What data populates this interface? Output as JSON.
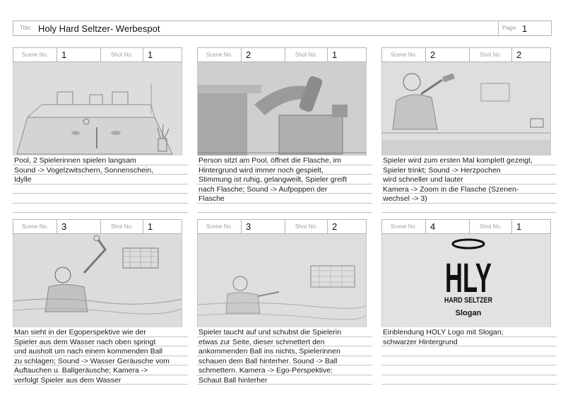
{
  "title": {
    "label": "Title:",
    "value": "Holy Hard Seltzer- Werbespot"
  },
  "page": {
    "label": "Page:",
    "value": "1"
  },
  "header_labels": {
    "scene": "Scene No.",
    "shot": "Shot No."
  },
  "panels": [
    {
      "scene": "1",
      "shot": "1",
      "description": [
        "Pool, 2 Spielerinnen spielen langsam",
        "Sound -> Vogelzwitschern, Sonnenschein,",
        "Idylle",
        "",
        "",
        ""
      ]
    },
    {
      "scene": "2",
      "shot": "1",
      "description": [
        "Person sitzt am Pool, öffnet die Flasche, im",
        "Hintergrund wird immer noch gespielt,",
        "Stimmung ist ruhig, gelangweilt, Spieler greift",
        "nach Flasche; Sound ->  Aufpoppen der",
        "Flasche",
        ""
      ]
    },
    {
      "scene": "2",
      "shot": "2",
      "description": [
        "Spieler wird zum ersten Mal komplett gezeigt,",
        "Spieler trinkt; Sound -> Herzpochen",
        "wird schneller und lauter",
        "Kamera -> Zoom in die Flasche (Szenen-",
        "wechsel -> 3)",
        ""
      ]
    },
    {
      "scene": "3",
      "shot": "1",
      "description": [
        "Man sieht in der Egoperspektive wie der",
        "Spieler aus dem Wasser nach oben springt",
        "und ausholt um nach einem kommenden Ball",
        "zu schlagen; Sound -> Wasser Geräusche vom",
        "Auftauchen u. Ballgeräusche; Kamera ->",
        "verfolgt Spieler aus dem Wasser"
      ]
    },
    {
      "scene": "3",
      "shot": "2",
      "description": [
        "Spieler taucht auf und schubst die Spielerin",
        "etwas zur Seite, dieser schmettert den",
        "ankommenden Ball ins nichts, Spielerinnen",
        "schauen dem Ball hinterher. Sound -> Ball",
        "schmettern. Kamera -> Ego-Perspektive:",
        "Schaut Ball hinterher"
      ]
    },
    {
      "scene": "4",
      "shot": "1",
      "description": [
        "Einblendung HOLY Logo mit Slogan;",
        "schwarzer Hintergrund",
        "",
        "",
        "",
        ""
      ]
    }
  ],
  "logo": {
    "main": "HLY",
    "sub": "HARD SELTZER",
    "slogan": "Slogan"
  }
}
